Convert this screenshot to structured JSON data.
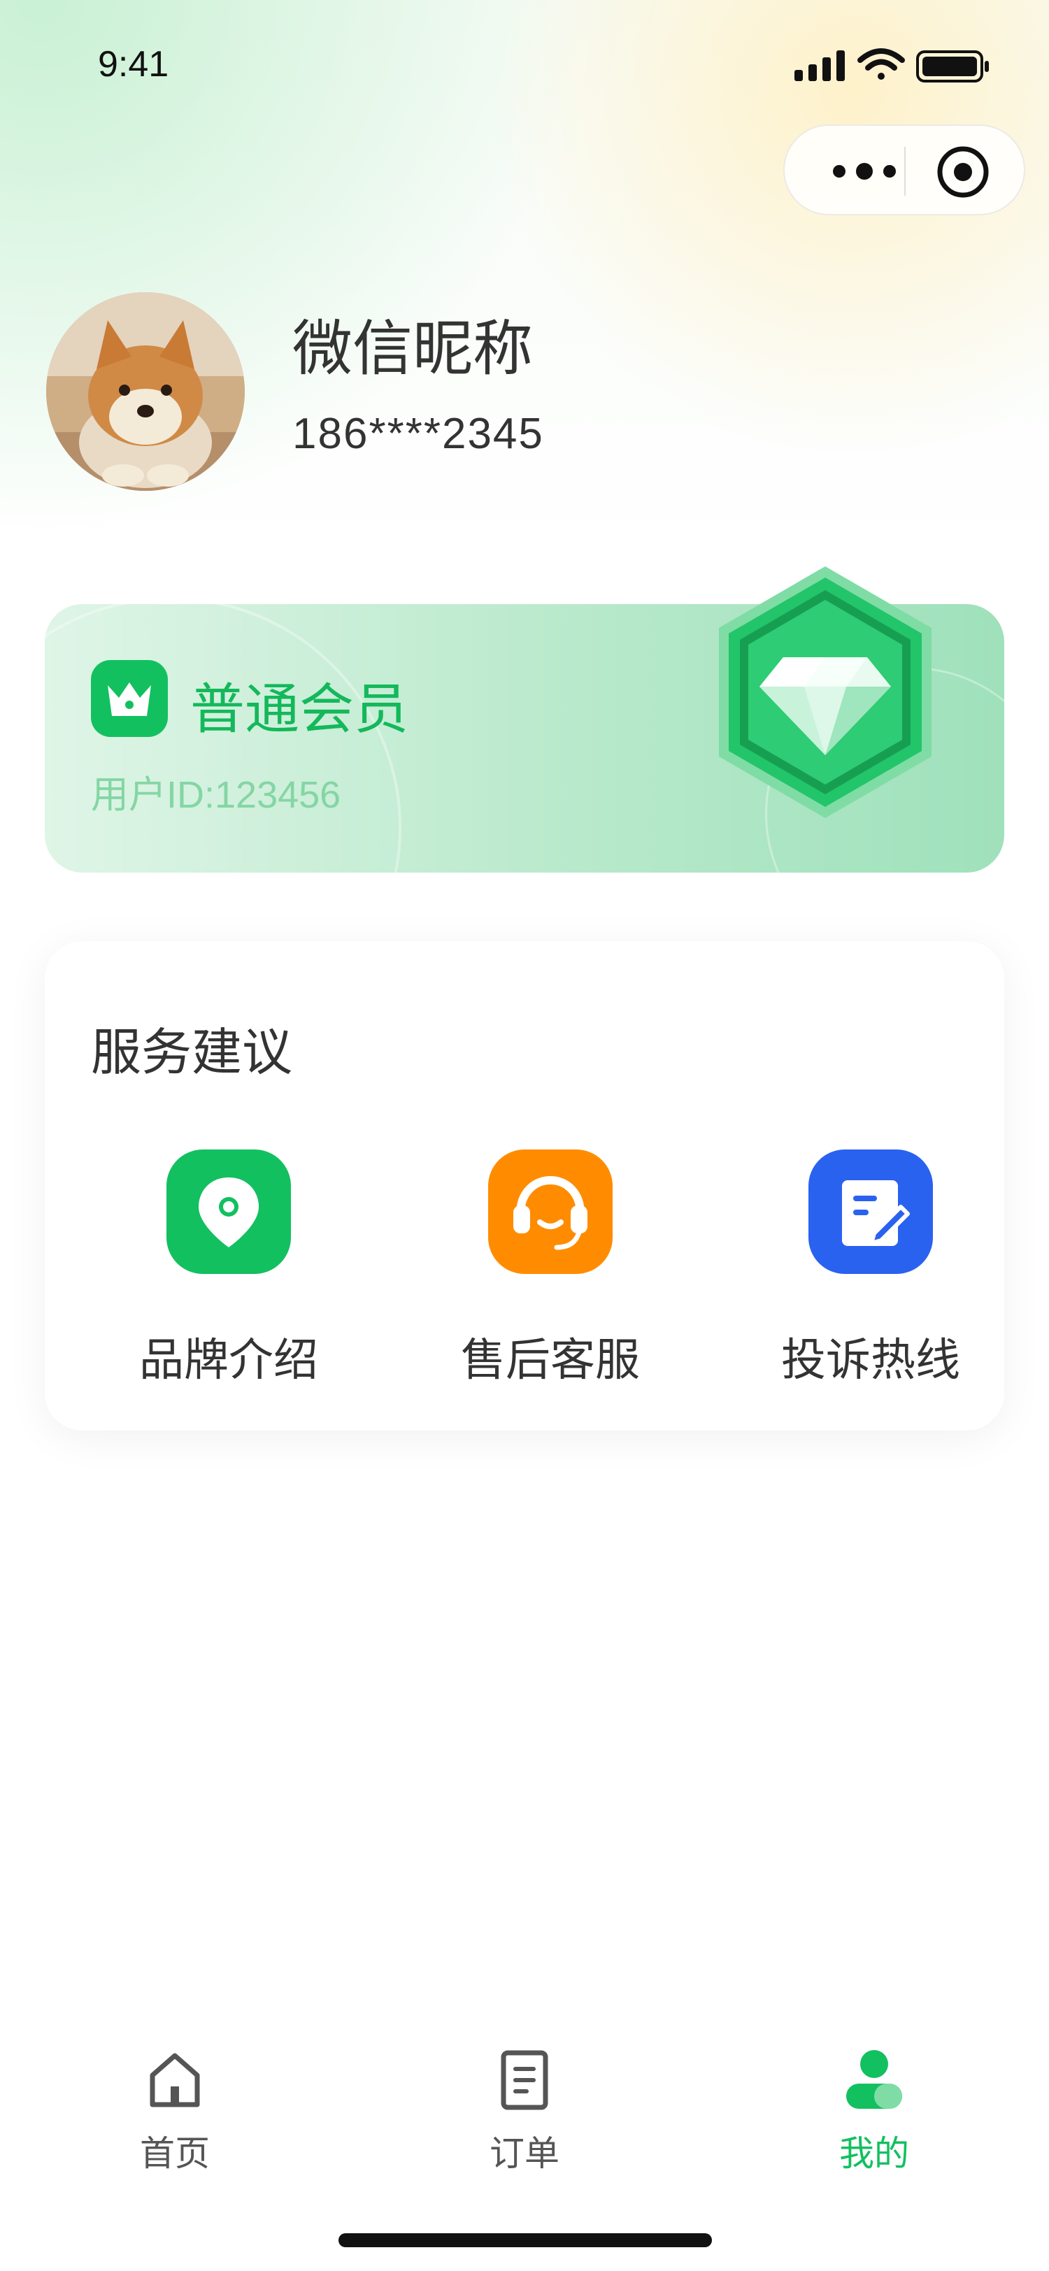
{
  "status_bar": {
    "time": "9:41"
  },
  "profile": {
    "nickname": "微信昵称",
    "phone": "186****2345"
  },
  "member_card": {
    "level": "普通会员",
    "user_id": "用户ID:123456"
  },
  "services": {
    "title": "服务建议",
    "items": [
      {
        "label": "品牌介绍",
        "icon": "location-pin-icon",
        "color": "#12c060"
      },
      {
        "label": "售后客服",
        "icon": "headset-icon",
        "color": "#ff8c00"
      },
      {
        "label": "投诉热线",
        "icon": "edit-document-icon",
        "color": "#2a62f0"
      }
    ]
  },
  "tab_bar": {
    "items": [
      {
        "label": "首页",
        "icon": "home-icon"
      },
      {
        "label": "订单",
        "icon": "order-list-icon"
      },
      {
        "label": "我的",
        "icon": "user-icon",
        "active": true
      }
    ]
  },
  "colors": {
    "brand_green": "#12c060",
    "orange": "#ff8c00",
    "blue": "#2a62f0"
  }
}
